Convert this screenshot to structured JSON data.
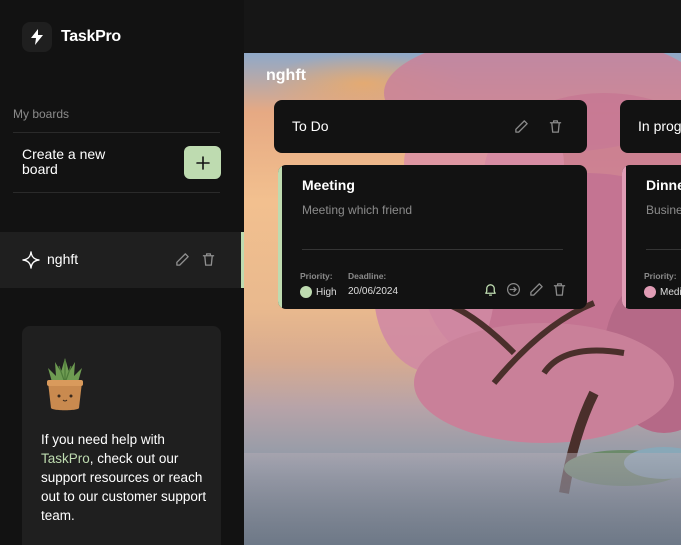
{
  "app": {
    "name": "TaskPro"
  },
  "sidebar": {
    "section_label": "My boards",
    "create_label": "Create a new board",
    "boards": [
      {
        "name": "nghft",
        "active": true
      }
    ],
    "help": {
      "prefix": "If you need help with ",
      "brand": "TaskPro",
      "suffix": ", check out our support resources or reach out to our customer support team."
    }
  },
  "board": {
    "title": "nghft",
    "columns": [
      {
        "title": "To Do",
        "cards": [
          {
            "title": "Meeting",
            "description": "Meeting which friend",
            "priority_label": "Priority:",
            "priority": "High",
            "priority_color": "#bedbb0",
            "deadline_label": "Deadline:",
            "deadline": "20/06/2024"
          }
        ]
      },
      {
        "title": "In progress",
        "cards": [
          {
            "title": "Dinner",
            "description": "Business",
            "priority_label": "Priority:",
            "priority": "Medium",
            "priority_color": "#e09cb5"
          }
        ]
      }
    ]
  },
  "colors": {
    "accent": "#bedbb0",
    "sidebar_bg": "#121212",
    "card_bg": "#121212"
  }
}
